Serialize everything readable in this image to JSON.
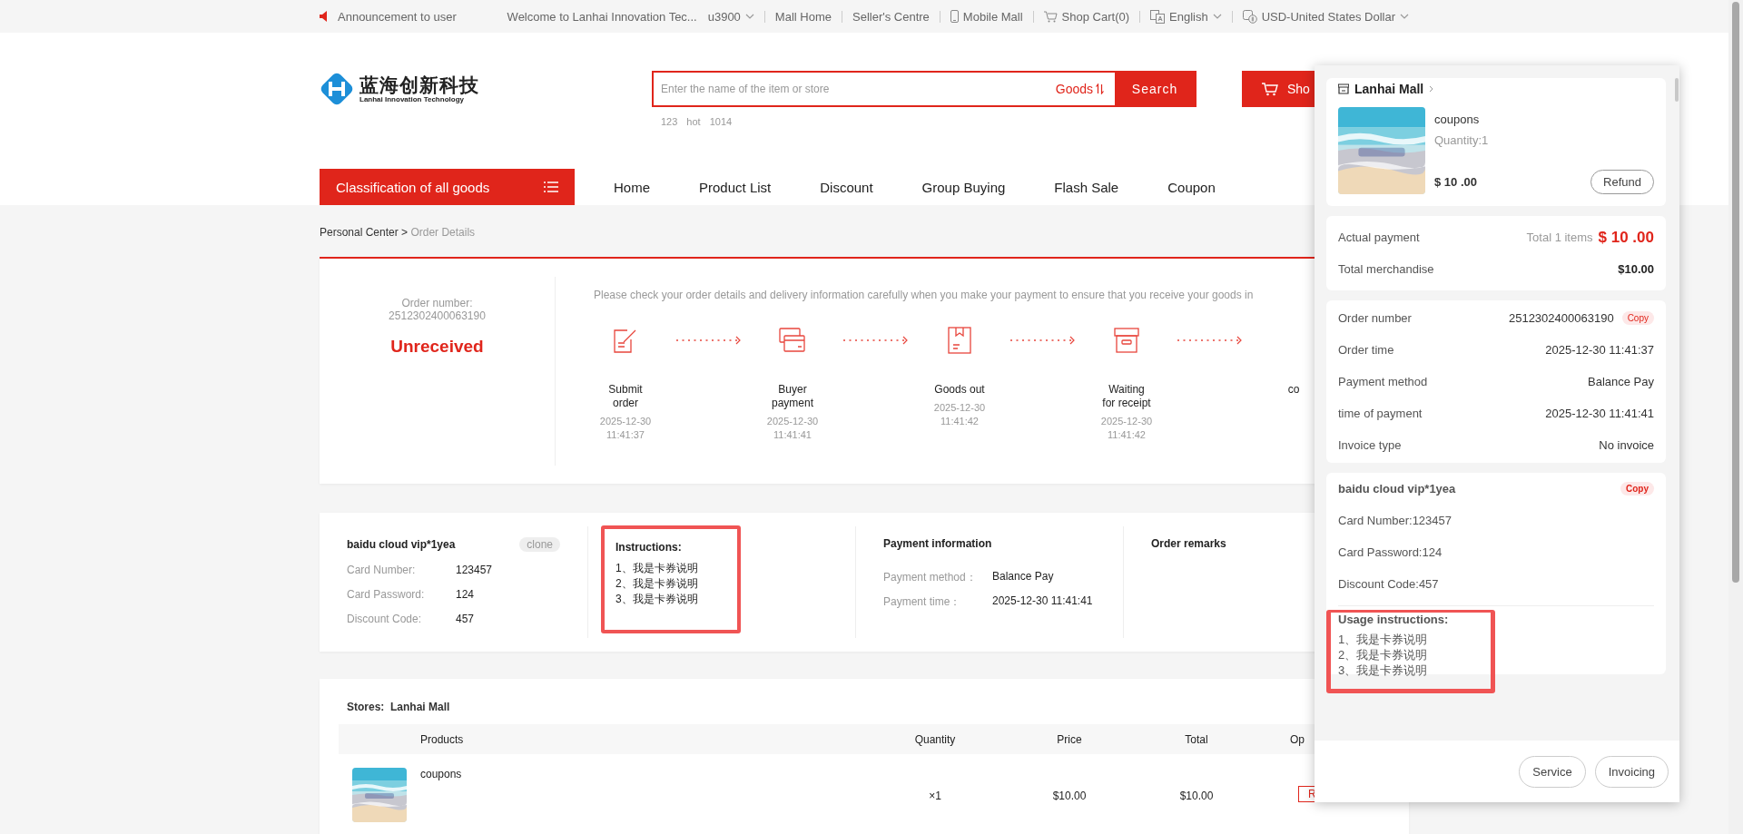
{
  "top_bar": {
    "announcement": "Announcement to user",
    "welcome": "Welcome to Lanhai Innovation Tec...",
    "user": "u3900",
    "links": [
      {
        "kind": "link",
        "label": "Mall Home"
      },
      {
        "kind": "link",
        "label": "Seller's Centre"
      },
      {
        "kind": "mobile",
        "label": "Mobile Mall"
      },
      {
        "kind": "cart",
        "label": "Shop Cart(0)"
      },
      {
        "kind": "language",
        "label": "English"
      },
      {
        "kind": "currency",
        "label": "USD-United States Dollar"
      }
    ]
  },
  "header": {
    "logo_title": "蓝海创新科技",
    "logo_subtitle": "Lanhai Innovation Technology",
    "search": {
      "placeholder": "Enter the name of the item or store",
      "scope": "Goods",
      "button": "Search"
    },
    "hot_words": [
      "123",
      "hot",
      "1014"
    ],
    "cart_button": "Sho"
  },
  "nav": {
    "category_button": "Classification of all goods",
    "items": [
      "Home",
      "Product List",
      "Discount",
      "Group Buying",
      "Flash Sale",
      "Coupon"
    ]
  },
  "breadcrumb": {
    "parent": "Personal Center",
    "separator": ">",
    "current": "Order Details"
  },
  "order": {
    "number_label": "Order number:",
    "number": "2512302400063190",
    "status": "Unreceived",
    "notice": "Please check your order details and delivery information carefully when you make your payment to ensure that you receive your goods in",
    "steps": [
      {
        "kind": "submit",
        "label": "Submit order",
        "time": "2025-12-30 11:41:37"
      },
      {
        "kind": "payment",
        "label": "Buyer payment",
        "time": "2025-12-30 11:41:41"
      },
      {
        "kind": "shipping",
        "label": "Goods out",
        "time": "2025-12-30 11:41:42"
      },
      {
        "kind": "receipt",
        "label": "Waiting for receipt",
        "time": "2025-12-30 11:41:42"
      },
      {
        "label": "co"
      }
    ]
  },
  "card_info": {
    "title": "baidu cloud vip*1yea",
    "badge": "clone",
    "fields": [
      {
        "label": "Card Number:",
        "value": "123457"
      },
      {
        "label": "Card Password:",
        "value": "124"
      },
      {
        "label": "Discount Code:",
        "value": "457"
      }
    ],
    "instructions": {
      "title": "Instructions:",
      "lines": [
        "1、我是卡券说明",
        "2、我是卡券说明",
        "3、我是卡券说明"
      ]
    },
    "payment": {
      "title": "Payment information",
      "fields": [
        {
          "label": "Payment method：",
          "value": "Balance Pay"
        },
        {
          "label": "Payment time：",
          "value": "2025-12-30 11:41:41"
        }
      ]
    },
    "remarks": {
      "title": "Order remarks"
    }
  },
  "store": {
    "label": "Stores:",
    "name": "Lanhai Mall",
    "columns": [
      "Products",
      "Quantity",
      "Price",
      "Total",
      "Op"
    ],
    "rows": [
      {
        "name": "coupons",
        "quantity": "×1",
        "price": "$10.00",
        "total": "$10.00",
        "action": "R"
      }
    ]
  },
  "panel": {
    "store": "Lanhai Mall",
    "item": {
      "name": "coupons",
      "quantity": "Quantity:1",
      "price": "$ 10 .00",
      "button": "Refund"
    },
    "payment": {
      "label": "Actual payment",
      "count": "Total  1 items",
      "amount": "$ 10 .00"
    },
    "merchandise": {
      "label": "Total merchandise",
      "value": "$10.00"
    },
    "details": [
      {
        "label": "Order number",
        "value": "2512302400063190",
        "copy": "Copy"
      },
      {
        "label": "Order time",
        "value": "2025-12-30 11:41:37"
      },
      {
        "label": "Payment method",
        "value": "Balance Pay"
      },
      {
        "label": "time of payment",
        "value": "2025-12-30 11:41:41"
      },
      {
        "label": "Invoice type",
        "value": "No invoice"
      }
    ],
    "card": {
      "title": "baidu cloud vip*1yea",
      "copy": "Copy",
      "lines": [
        "Card Number:123457",
        "Card Password:124",
        "Discount Code:457"
      ],
      "usage_title": "Usage instructions:",
      "usage_lines": [
        "1、我是卡券说明",
        "2、我是卡券说明",
        "3、我是卡券说明"
      ]
    },
    "buttons": [
      "Service",
      "Invoicing"
    ]
  }
}
